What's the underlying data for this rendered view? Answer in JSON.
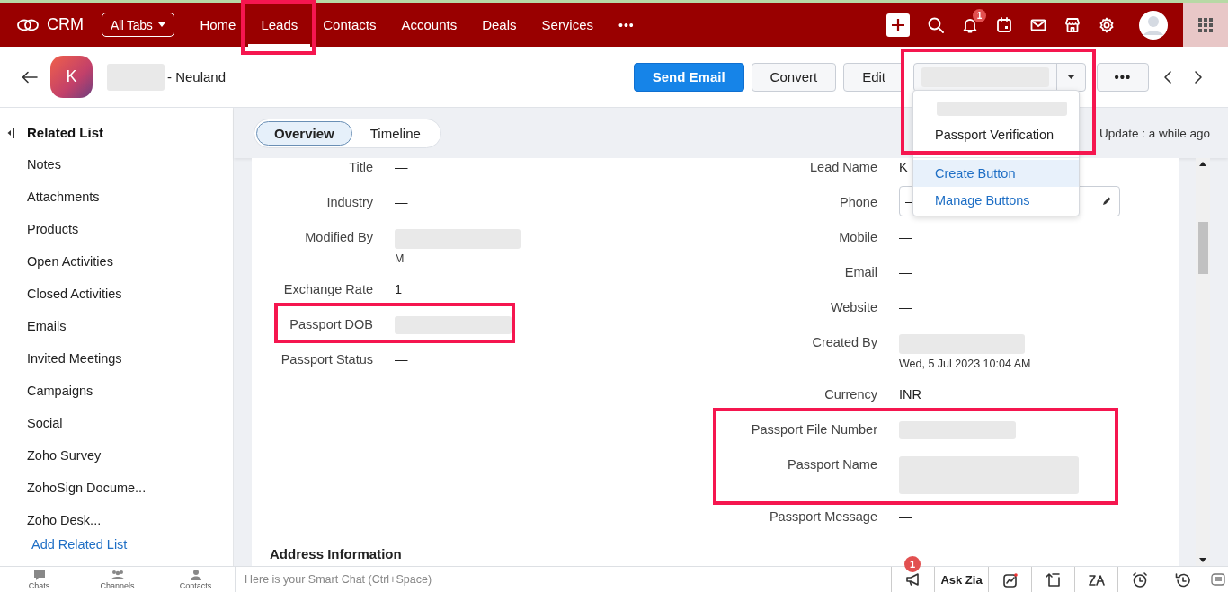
{
  "top_nav": {
    "brand": "CRM",
    "all_tabs": "All Tabs",
    "tabs": [
      {
        "label": "Home",
        "selected": false
      },
      {
        "label": "Leads",
        "selected": true
      },
      {
        "label": "Contacts",
        "selected": false
      },
      {
        "label": "Accounts",
        "selected": false
      },
      {
        "label": "Deals",
        "selected": false
      },
      {
        "label": "Services",
        "selected": false
      }
    ],
    "more": "•••",
    "notification_count": "1"
  },
  "record_header": {
    "avatar_letter": "K",
    "name_suffix": "- Neuland",
    "buttons": [
      {
        "label": "Send Email",
        "kind": "primary"
      },
      {
        "label": "Convert",
        "kind": "plain"
      },
      {
        "label": "Edit",
        "kind": "plain"
      }
    ],
    "more": "•••"
  },
  "custom_button_menu": {
    "items": [
      {
        "kind": "blurred"
      },
      {
        "label": "Passport Verification",
        "kind": "action",
        "hovered": false
      },
      {
        "label": "Create Button",
        "kind": "link",
        "hovered": true
      },
      {
        "label": "Manage Buttons",
        "kind": "link",
        "hovered": false
      }
    ]
  },
  "sidebar": {
    "title": "Related List",
    "items": [
      "Notes",
      "Attachments",
      "Products",
      "Open Activities",
      "Closed Activities",
      "Emails",
      "Invited Meetings",
      "Campaigns",
      "Social",
      "Zoho Survey",
      "ZohoSign Docume...",
      "Zoho Desk..."
    ],
    "add_link": "Add Related List"
  },
  "view_tabs": [
    {
      "label": "Overview",
      "selected": true
    },
    {
      "label": "Timeline",
      "selected": false
    }
  ],
  "last_update": "Update : a while ago",
  "fields_left": [
    {
      "label": "Title",
      "value": "—",
      "kind": "text"
    },
    {
      "label": "Industry",
      "value": "—",
      "kind": "text"
    },
    {
      "label": "Modified By",
      "value": "M",
      "kind": "blurred_stamp"
    },
    {
      "label": "Exchange Rate",
      "value": "1",
      "kind": "text"
    },
    {
      "label": "Passport DOB",
      "kind": "blurred"
    },
    {
      "label": "Passport Status",
      "value": "—",
      "kind": "text"
    }
  ],
  "fields_right": [
    {
      "label": "Lead Name",
      "value": "K",
      "kind": "text"
    },
    {
      "label": "Phone",
      "value": "—",
      "kind": "phone"
    },
    {
      "label": "Mobile",
      "value": "—",
      "kind": "text"
    },
    {
      "label": "Email",
      "value": "—",
      "kind": "text"
    },
    {
      "label": "Website",
      "value": "—",
      "kind": "text"
    },
    {
      "label": "Created By",
      "value": "Wed, 5 Jul 2023 10:04 AM",
      "kind": "blurred_stamp"
    },
    {
      "label": "Currency",
      "value": "INR",
      "kind": "text"
    },
    {
      "label": "Passport File Number",
      "kind": "blurred"
    },
    {
      "label": "Passport Name",
      "kind": "blurred_tall"
    },
    {
      "label": "Passport Message",
      "value": "—",
      "kind": "text"
    }
  ],
  "section_title": "Address Information",
  "bottom_bar": {
    "apps": [
      "Chats",
      "Channels",
      "Contacts"
    ],
    "chat_placeholder": "Here is your Smart Chat (Ctrl+Space)",
    "announcement_count": "1",
    "ask_zia": "Ask Zia"
  }
}
